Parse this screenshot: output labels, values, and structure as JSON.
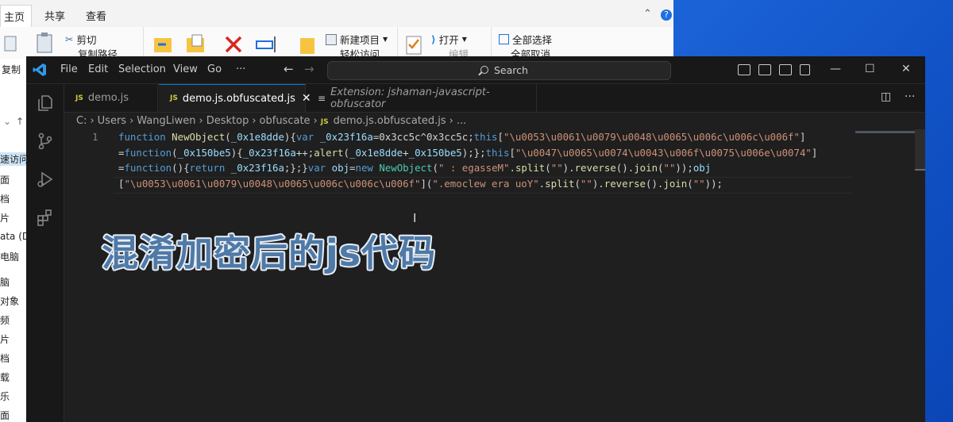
{
  "explorer": {
    "tabs": [
      "主页",
      "共享",
      "查看"
    ],
    "ribbon": {
      "copy_label": "复制",
      "cut_label": "剪切",
      "copy_path_label": "复制路径",
      "new_item_label": "新建项目",
      "easy_access_label": "轻松访问",
      "open_label": "打开",
      "edit_label": "编辑",
      "select_all_label": "全部选择",
      "select_none_label": "全部取消"
    },
    "nav_items": [
      "速访问",
      "面",
      "档",
      "片",
      "ata (D:",
      "电脑",
      "脑",
      "对象",
      "频",
      "片",
      "档",
      "载",
      "乐",
      "面"
    ]
  },
  "vscode": {
    "menu": [
      "File",
      "Edit",
      "Selection",
      "View",
      "Go",
      "···"
    ],
    "search_placeholder": "Search",
    "tabs": [
      {
        "label": "demo.js",
        "badge": "JS",
        "active": false
      },
      {
        "label": "demo.js.obfuscated.js",
        "badge": "JS",
        "active": true
      },
      {
        "label": "Extension: jshaman-javascript-obfuscator",
        "active": false
      }
    ],
    "breadcrumb": [
      "C:",
      "Users",
      "WangLiwen",
      "Desktop",
      "obfuscate",
      "demo.js.obfuscated.js",
      "..."
    ],
    "breadcrumb_badge": "JS",
    "line_number": "1",
    "overlay_caption": "混淆加密后的js代码"
  },
  "colors": {
    "keyword": "#569cd6",
    "function": "#4ec9b0",
    "string": "#ce9178",
    "accent": "#0078d4"
  }
}
